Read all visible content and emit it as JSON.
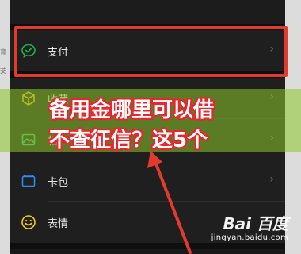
{
  "left_fragments": [
    "育",
    "芠"
  ],
  "menu": {
    "items": [
      {
        "label": "支付",
        "icon": "wechat-pay-icon"
      },
      {
        "label": "收藏",
        "icon": "favorites-cube-icon"
      },
      {
        "label": "相",
        "icon": "album-icon"
      },
      {
        "label": "卡包",
        "icon": "card-wallet-icon"
      },
      {
        "label": "表情",
        "icon": "emoji-icon"
      }
    ],
    "chevron": "›"
  },
  "overlay": {
    "title_line1": "备用金哪里可以借",
    "title_line2": "不查征信？这5个"
  },
  "watermark": {
    "brand": "Bai 百度",
    "site": "jingyan.baidu.com"
  },
  "colors": {
    "highlight_border": "#e23b2e",
    "pay_green": "#22b04b",
    "favorites_orange": "#f4a21d",
    "album_green": "#39b36b",
    "card_blue": "#2a8cf0",
    "emoji_yellow": "#f5c518",
    "overlay_green": "#8cc828"
  }
}
